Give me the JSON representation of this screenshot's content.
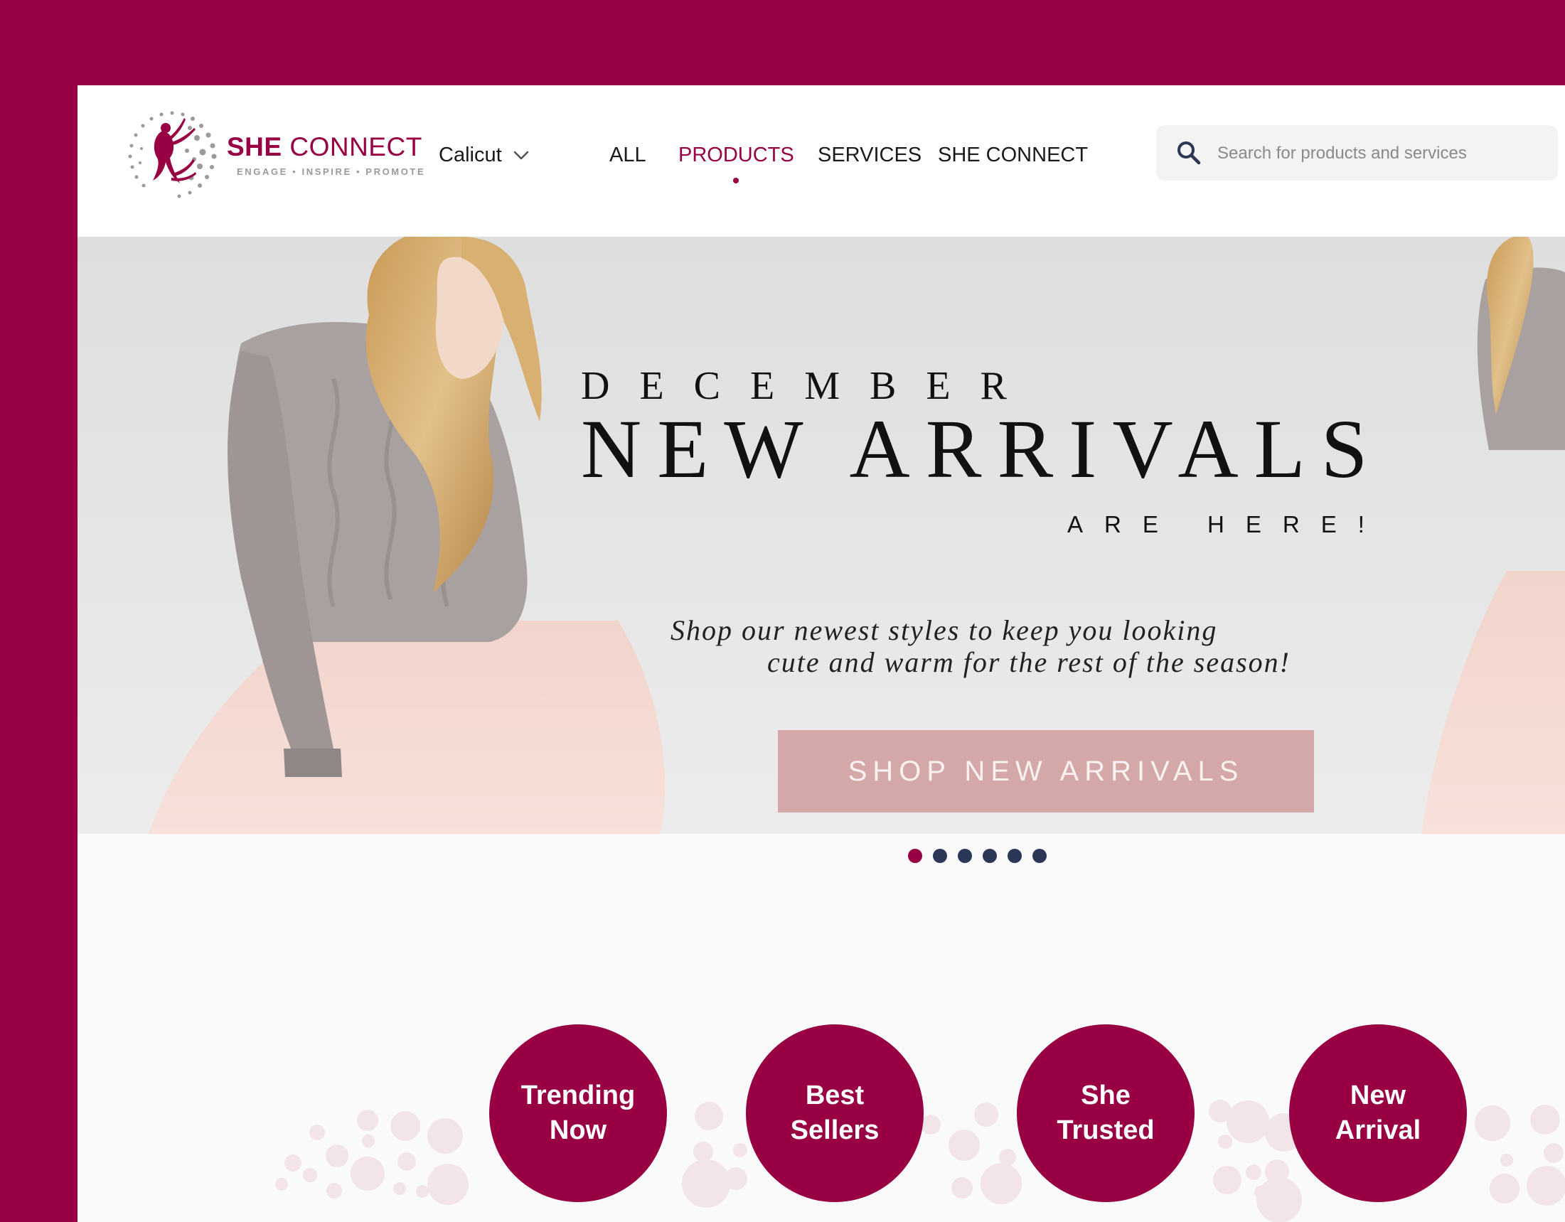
{
  "brand": {
    "name_bold": "SHE",
    "name_rest": "CONNECT",
    "tagline": "ENGAGE • INSPIRE • PROMOTE"
  },
  "location": {
    "label": "Calicut",
    "icon": "chevron-down-icon"
  },
  "nav": {
    "items": [
      {
        "label": "ALL",
        "active": false
      },
      {
        "label": "PRODUCTS",
        "active": true
      },
      {
        "label": "SERVICES",
        "active": false
      },
      {
        "label": "SHE CONNECT",
        "active": false
      }
    ]
  },
  "search": {
    "placeholder": "Search for products and services",
    "value": "",
    "icon": "search-icon"
  },
  "hero": {
    "kicker": "DECEMBER",
    "title": "NEW ARRIVALS",
    "subtitle": "ARE HERE!",
    "description_line1": "Shop our newest styles to keep you looking",
    "description_line2": "cute and warm for the rest of the season!",
    "cta_label": "SHOP NEW ARRIVALS"
  },
  "carousel": {
    "slide_count": 6,
    "active_index": 1
  },
  "categories": [
    {
      "label": "Trending Now"
    },
    {
      "label": "Best Sellers"
    },
    {
      "label": "She Trusted"
    },
    {
      "label": "New Arrival"
    }
  ],
  "colors": {
    "brand": "#990044",
    "frame": "#990044",
    "cta": "#d4a8a8",
    "carousel_dot": "#2c3656",
    "bubble": "#f2e4e9"
  }
}
